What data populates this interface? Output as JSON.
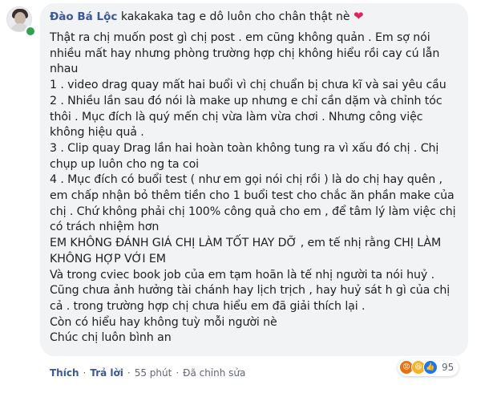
{
  "comment": {
    "author": "Đào Bá Lộc",
    "first_line": "kakakaka tag e dô luôn cho chân thật nè",
    "body": "Thật ra chị muốn post gì chị post . em cũng không quản . Em sợ nói nhiều mất hay nhưng phòng trường hợp chị không hiểu rồi cay cú lẫn nhau\n1 . video drag quay mất hai buổi vì chị chuẩn bị chưa kĩ và sai yêu cầu\n2 . Nhiều lần sau đó nói là make up nhưng e chỉ cần dặm và chỉnh tóc thôi . Mục đích là quý mến chị vừa làm vừa chơi . Nhưng công việc không hiệu quả .\n3 . Clip quay Drag lần hai hoàn toàn không tung ra vì xấu đó chị . Chị chụp up luôn cho ng ta coi\n4 . Mục đích có buổi test ( như em gọi nói chị rồi ) là do chị hay quên , em chấp nhận bỏ thêm tiền cho 1 buổi test cho chắc ăn phần make của chị . Chứ không phải chị 100% công quả cho em , để tâm lý làm việc chị có trách nhiệm hơn\nEM KHÔNG ĐÁNH GIÁ CHỊ LÀM TỐT HAY DỠ , em tế nhị rằng CHỊ LÀM KHÔNG HỢP VỚI EM\nVà trong cviec book job của em tạm hoãn là tế nhị người ta nói huỷ .\nCũng chưa ảnh hưởng tài chánh hay lịch trịch , hay huỷ sát h gì của chị cả . trong trường hợp chị chưa hiểu em đã giải thích lại .\nCòn có hiểu hay không tuỳ mỗi người nè\nChúc chị luôn bình an"
  },
  "icons": {
    "heart": "❤",
    "angry": "😡",
    "haha": "😆",
    "like": "👍"
  },
  "reactions": {
    "count": "95"
  },
  "actions": {
    "like": "Thích",
    "reply": "Trả lời",
    "time": "55 phút",
    "edited": "Đã chỉnh sửa",
    "separator": "·"
  },
  "colors": {
    "author": "#385898",
    "bubble": "#f2f3f5",
    "online": "#31a24c",
    "heart": "#e0245e"
  }
}
